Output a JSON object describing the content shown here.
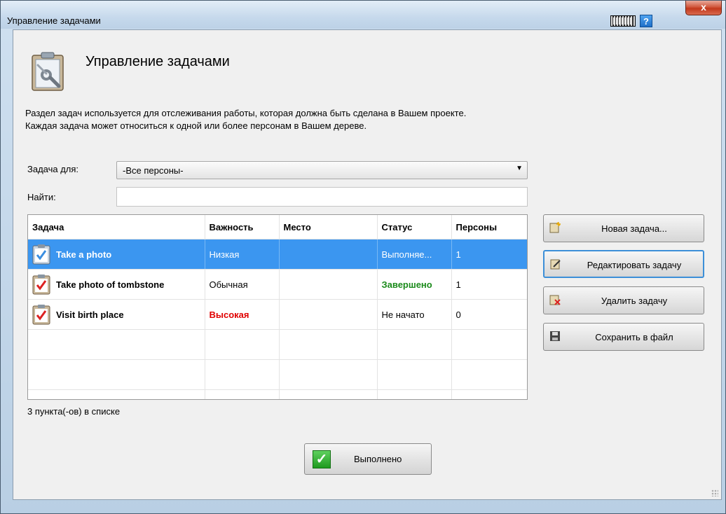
{
  "window": {
    "title": "Управление задачами",
    "close_glyph": "x",
    "help_glyph": "?",
    "icons": {
      "keyboard": "keyboard-icon",
      "help": "help-icon",
      "header": "clipboard-wrench-icon"
    }
  },
  "header": {
    "title": "Управление задачами",
    "description_line1": "Раздел задач используется для отслеживания работы, которая должна быть сделана в Вашем проекте.",
    "description_line2": "Каждая задача может относиться к одной или более персонам в Вашем дереве."
  },
  "filter": {
    "task_for_label": "Задача для:",
    "task_for_value": "-Все персоны-",
    "find_label": "Найти:",
    "find_value": ""
  },
  "table": {
    "columns": [
      "Задача",
      "Важность",
      "Место",
      "Статус",
      "Персоны"
    ],
    "rows": [
      {
        "task": "Take a photo",
        "importance": "Низкая",
        "place": "",
        "status": "Выполняе...",
        "persons": "1",
        "selected": true
      },
      {
        "task": "Take photo of tombstone",
        "importance": "Обычная",
        "place": "",
        "status": "Завершено",
        "persons": "1",
        "selected": false
      },
      {
        "task": "Visit birth place",
        "importance": "Высокая",
        "place": "",
        "status": "Не начато",
        "persons": "0",
        "selected": false
      }
    ],
    "count_text": "3 пункта(-ов) в списке"
  },
  "colors": {
    "selection": "#3b96f0",
    "high_importance": "#e00000",
    "completed_status": "#1a8a1a"
  },
  "actions": {
    "new_task": "Новая задача...",
    "edit_task": "Редактировать задачу",
    "delete_task": "Удалить задачу",
    "save_to_file": "Сохранить в файл",
    "done": "Выполнено"
  }
}
